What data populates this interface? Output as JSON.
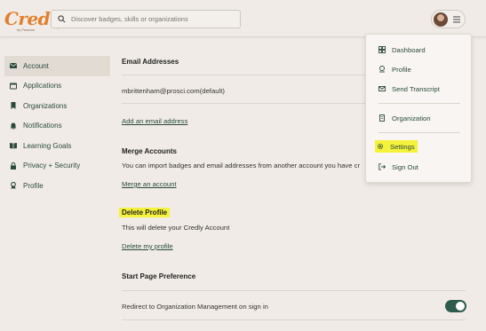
{
  "brand": {
    "name": "Credly",
    "sub": "by Pearson"
  },
  "search": {
    "placeholder": "Discover badges, skills or organizations",
    "value": ""
  },
  "sidebar": {
    "items": [
      {
        "label": "Account",
        "icon": "envelope-icon",
        "active": true
      },
      {
        "label": "Applications",
        "icon": "app-window-icon"
      },
      {
        "label": "Organizations",
        "icon": "bookmark-icon"
      },
      {
        "label": "Notifications",
        "icon": "bell-icon"
      },
      {
        "label": "Learning Goals",
        "icon": "book-icon"
      },
      {
        "label": "Privacy + Security",
        "icon": "lock-icon"
      },
      {
        "label": "Profile",
        "icon": "ribbon-icon"
      }
    ]
  },
  "email": {
    "heading": "Email Addresses",
    "address": "mbrittenham@prosci.com(default)",
    "add_link": "Add an email address"
  },
  "merge": {
    "heading": "Merge Accounts",
    "description": "You can import badges and email addresses from another account you have cr",
    "link": "Merge an account"
  },
  "delete": {
    "heading": "Delete Profile",
    "description": "This will delete your Credly Account",
    "link": "Delete my profile"
  },
  "start_page": {
    "heading": "Start Page Preference",
    "option": "Redirect to Organization Management on sign in",
    "enabled": true
  },
  "menu": {
    "items": [
      {
        "label": "Dashboard",
        "icon": "grid-icon"
      },
      {
        "label": "Profile",
        "icon": "badge-icon"
      },
      {
        "label": "Send Transcript",
        "icon": "envelope-icon"
      },
      {
        "label": "Organization",
        "icon": "building-icon"
      },
      {
        "label": "Settings",
        "icon": "gear-icon",
        "highlighted": true
      },
      {
        "label": "Sign Out",
        "icon": "sign-out-icon"
      }
    ]
  },
  "colors": {
    "accent": "#2d5c4c",
    "brand": "#e07f2c",
    "highlight": "#f4f23a",
    "background": "#f0ebe6"
  }
}
